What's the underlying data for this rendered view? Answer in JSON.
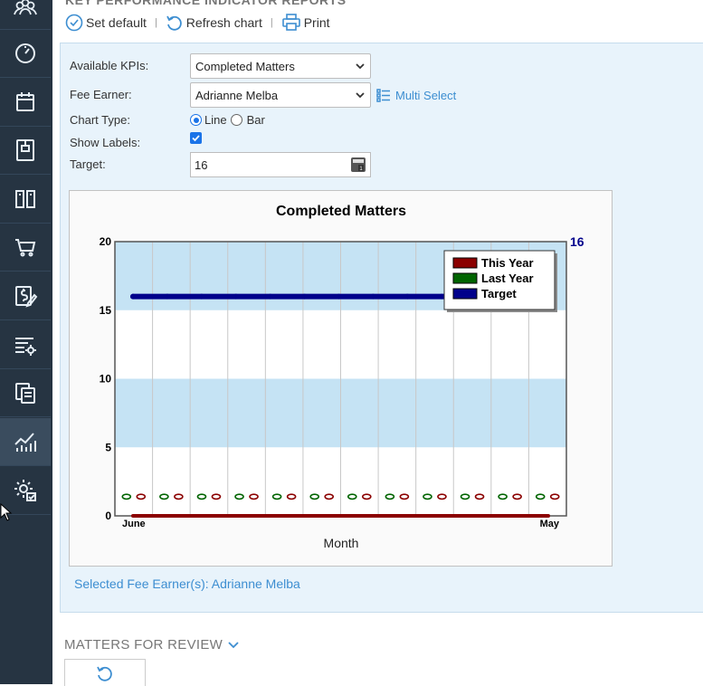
{
  "page": {
    "section_title_partial": "KEY PERFORMANCE INDICATOR REPORTS"
  },
  "sidebar": {
    "items": [
      {
        "icon": "users-icon"
      },
      {
        "icon": "dashboard-gauge-icon"
      },
      {
        "icon": "calendar-icon"
      },
      {
        "icon": "matter-file-icon"
      },
      {
        "icon": "library-books-icon"
      },
      {
        "icon": "cart-icon"
      },
      {
        "icon": "billing-dollar-icon"
      },
      {
        "icon": "settings-list-icon"
      },
      {
        "icon": "documents-icon"
      },
      {
        "icon": "reports-chart-icon",
        "active": true
      },
      {
        "icon": "admin-settings-icon"
      }
    ]
  },
  "toolbar": {
    "set_default": "Set default",
    "refresh_chart": "Refresh chart",
    "print": "Print"
  },
  "form": {
    "available_kpis_label": "Available KPIs:",
    "available_kpis_value": "Completed Matters",
    "fee_earner_label": "Fee Earner:",
    "fee_earner_value": "Adrianne Melba",
    "multi_select": "Multi Select",
    "chart_type_label": "Chart Type:",
    "chart_type_line": "Line",
    "chart_type_bar": "Bar",
    "chart_type_selected": "Line",
    "show_labels_label": "Show Labels:",
    "show_labels_checked": true,
    "target_label": "Target:",
    "target_value": "16"
  },
  "chart_data": {
    "type": "line",
    "title": "Completed Matters",
    "xlabel": "Month",
    "ylabel": "",
    "ylim": [
      0,
      20
    ],
    "yticks": [
      0,
      5,
      10,
      15,
      20
    ],
    "x_tick_labels": [
      "June",
      "May"
    ],
    "categories": [
      "June",
      "",
      "",
      "",
      "",
      "",
      "",
      "",
      "",
      "",
      "",
      "May"
    ],
    "grid": true,
    "legend_position": "top-right",
    "target_label": "16",
    "series": [
      {
        "name": "This Year",
        "color": "#8b0000",
        "values": [
          0,
          0,
          0,
          0,
          0,
          0,
          0,
          0,
          0,
          0,
          0,
          0
        ]
      },
      {
        "name": "Last Year",
        "color": "#006400",
        "values": [
          0,
          0,
          0,
          0,
          0,
          0,
          0,
          0,
          0,
          0,
          0,
          0
        ]
      },
      {
        "name": "Target",
        "color": "#00008b",
        "values": [
          16,
          16,
          16,
          16,
          16,
          16,
          16,
          16,
          16,
          16,
          16,
          16
        ]
      }
    ]
  },
  "footer": {
    "selected_fee_earners": "Selected Fee Earner(s): Adrianne Melba"
  },
  "review": {
    "title": "MATTERS FOR REVIEW"
  }
}
